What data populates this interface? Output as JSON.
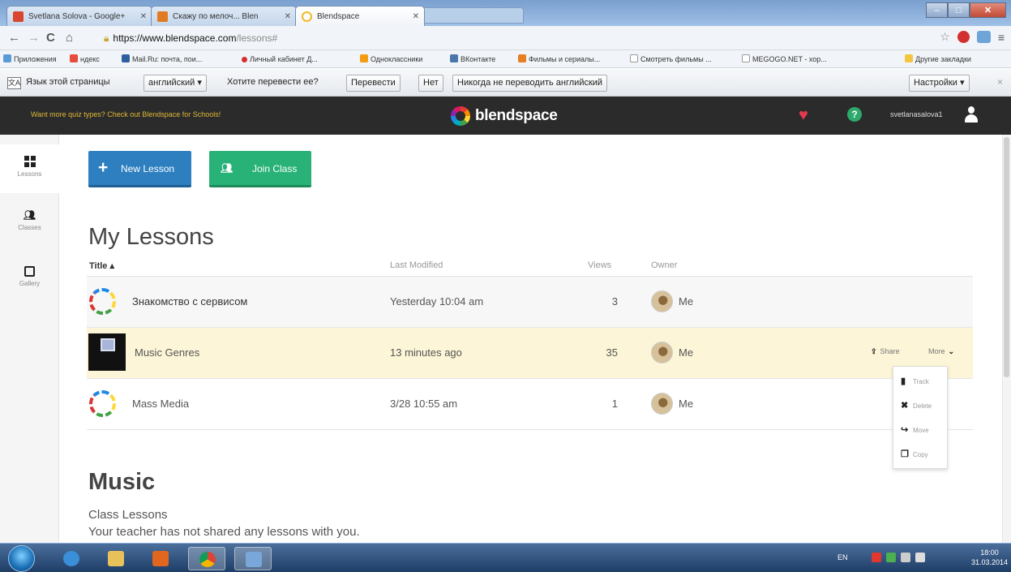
{
  "browser": {
    "tabs": [
      {
        "title": "Svetlana Solova - Google+",
        "icon_color": "#d9452f"
      },
      {
        "title": "Скажу по мелоч... Blen",
        "icon_color": "#e07b24"
      },
      {
        "title": "Blendspace",
        "icon_color": "#f0b928"
      }
    ],
    "url_host": "https://www.blendspace.com",
    "url_path": "/lessons#",
    "bookmarks": [
      "Приложения",
      "ндекс",
      "Mail.Ru: почта, пои...",
      "Личный кабинет Д...",
      "Одноклассники",
      "ВКонтакте",
      "Фильмы и сериалы...",
      "Смотреть фильмы ...",
      "MEGOGO.NET - хор...",
      "Другие закладки"
    ],
    "translate_bar": {
      "page_language_label": "Язык этой страницы",
      "language_select": "английский",
      "question": "Хотите перевести ее?",
      "translate_button": "Перевести",
      "no_button": "Нет",
      "never_button": "Никогда не переводить английский",
      "settings_button": "Настройки",
      "close": "×"
    }
  },
  "app": {
    "promo_text": "Want more quiz types? Check out Blendspace for Schools!",
    "brand": "blendspace",
    "username": "svetlanasalova1",
    "help_label": "?"
  },
  "sidebar": {
    "items": [
      {
        "label": "Lessons"
      },
      {
        "label": "Classes"
      },
      {
        "label": "Gallery"
      }
    ]
  },
  "actions": {
    "new_lesson": "New Lesson",
    "join_class": "Join Class"
  },
  "my_lessons": {
    "heading": "My Lessons",
    "columns": {
      "title": "Title",
      "last_modified": "Last Modified",
      "views": "Views",
      "owner": "Owner"
    },
    "rows": [
      {
        "title": "Знакомство с сервисом",
        "modified": "Yesterday 10:04 am",
        "views": "3",
        "owner": "Me"
      },
      {
        "title": "Music Genres",
        "modified": "13 minutes ago",
        "views": "35",
        "owner": "Me"
      },
      {
        "title": "Mass Media",
        "modified": "3/28 10:55 am",
        "views": "1",
        "owner": "Me"
      }
    ],
    "row_actions": {
      "share": "Share",
      "more": "More"
    },
    "more_menu": [
      "Track",
      "Delete",
      "Move",
      "Copy"
    ]
  },
  "music": {
    "heading": "Music",
    "class_lessons": "Class Lessons",
    "empty_message": "Your teacher has not shared any lessons with you."
  },
  "taskbar": {
    "language": "EN",
    "time": "18:00",
    "date": "31.03.2014"
  }
}
